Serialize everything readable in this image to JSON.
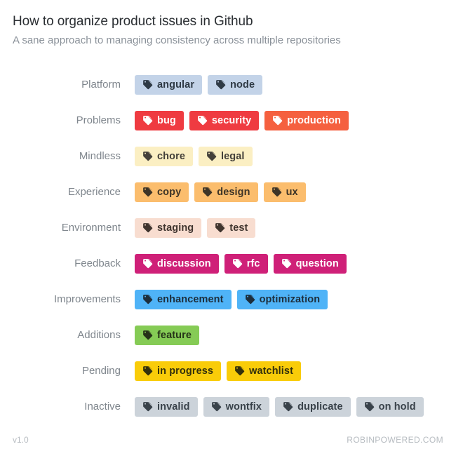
{
  "header": {
    "title": "How to organize product issues in Github",
    "subtitle": "A sane approach to managing consistency across multiple repositories"
  },
  "icon": {
    "name": "tag-icon"
  },
  "footer": {
    "version": "v1.0",
    "site": "ROBINPOWERED.COM"
  },
  "palette": {
    "platform_bg": "#c3d3e8",
    "platform_fg": "#2f3a45",
    "problems_bg": "#ef3b41",
    "problems_alt_bg": "#f5603f",
    "problems_fg": "#ffffff",
    "mindless_bg": "#fbefc3",
    "mindless_fg": "#44403a",
    "experience_bg": "#fbbd6d",
    "experience_fg": "#3d3427",
    "environment_bg": "#f8ddd0",
    "environment_fg": "#40352f",
    "feedback_bg": "#cf2078",
    "feedback_fg": "#ffffff",
    "improvements_bg": "#4fb3f7",
    "improvements_fg": "#1d2e3c",
    "additions_bg": "#85cb55",
    "additions_fg": "#253318",
    "pending_bg": "#f9cc09",
    "pending_fg": "#33300c",
    "inactive_bg": "#ccd3da",
    "inactive_fg": "#39424a",
    "label_color": "#7f868d",
    "title_color": "#2b2f33",
    "subtitle_color": "#8a9199",
    "footer_color": "#b7bcc1"
  },
  "rows": [
    {
      "label": "Platform",
      "tags": [
        {
          "text": "angular",
          "bg": "#c3d3e8",
          "fg": "#2f3a45"
        },
        {
          "text": "node",
          "bg": "#c3d3e8",
          "fg": "#2f3a45"
        }
      ]
    },
    {
      "label": "Problems",
      "tags": [
        {
          "text": "bug",
          "bg": "#ef3b41",
          "fg": "#ffffff"
        },
        {
          "text": "security",
          "bg": "#ef3b41",
          "fg": "#ffffff"
        },
        {
          "text": "production",
          "bg": "#f5603f",
          "fg": "#ffffff"
        }
      ]
    },
    {
      "label": "Mindless",
      "tags": [
        {
          "text": "chore",
          "bg": "#fbefc3",
          "fg": "#44403a"
        },
        {
          "text": "legal",
          "bg": "#fbefc3",
          "fg": "#44403a"
        }
      ]
    },
    {
      "label": "Experience",
      "tags": [
        {
          "text": "copy",
          "bg": "#fbbd6d",
          "fg": "#3d3427"
        },
        {
          "text": "design",
          "bg": "#fbbd6d",
          "fg": "#3d3427"
        },
        {
          "text": "ux",
          "bg": "#fbbd6d",
          "fg": "#3d3427"
        }
      ]
    },
    {
      "label": "Environment",
      "tags": [
        {
          "text": "staging",
          "bg": "#f8ddd0",
          "fg": "#40352f"
        },
        {
          "text": "test",
          "bg": "#f8ddd0",
          "fg": "#40352f"
        }
      ]
    },
    {
      "label": "Feedback",
      "tags": [
        {
          "text": "discussion",
          "bg": "#cf2078",
          "fg": "#ffffff"
        },
        {
          "text": "rfc",
          "bg": "#cf2078",
          "fg": "#ffffff"
        },
        {
          "text": "question",
          "bg": "#cf2078",
          "fg": "#ffffff"
        }
      ]
    },
    {
      "label": "Improvements",
      "tags": [
        {
          "text": "enhancement",
          "bg": "#4fb3f7",
          "fg": "#1d2e3c"
        },
        {
          "text": "optimization",
          "bg": "#4fb3f7",
          "fg": "#1d2e3c"
        }
      ]
    },
    {
      "label": "Additions",
      "tags": [
        {
          "text": "feature",
          "bg": "#85cb55",
          "fg": "#253318"
        }
      ]
    },
    {
      "label": "Pending",
      "tags": [
        {
          "text": "in progress",
          "bg": "#f9cc09",
          "fg": "#33300c"
        },
        {
          "text": "watchlist",
          "bg": "#f9cc09",
          "fg": "#33300c"
        }
      ]
    },
    {
      "label": "Inactive",
      "tags": [
        {
          "text": "invalid",
          "bg": "#ccd3da",
          "fg": "#39424a"
        },
        {
          "text": "wontfix",
          "bg": "#ccd3da",
          "fg": "#39424a"
        },
        {
          "text": "duplicate",
          "bg": "#ccd3da",
          "fg": "#39424a"
        },
        {
          "text": "on hold",
          "bg": "#ccd3da",
          "fg": "#39424a"
        }
      ]
    }
  ]
}
